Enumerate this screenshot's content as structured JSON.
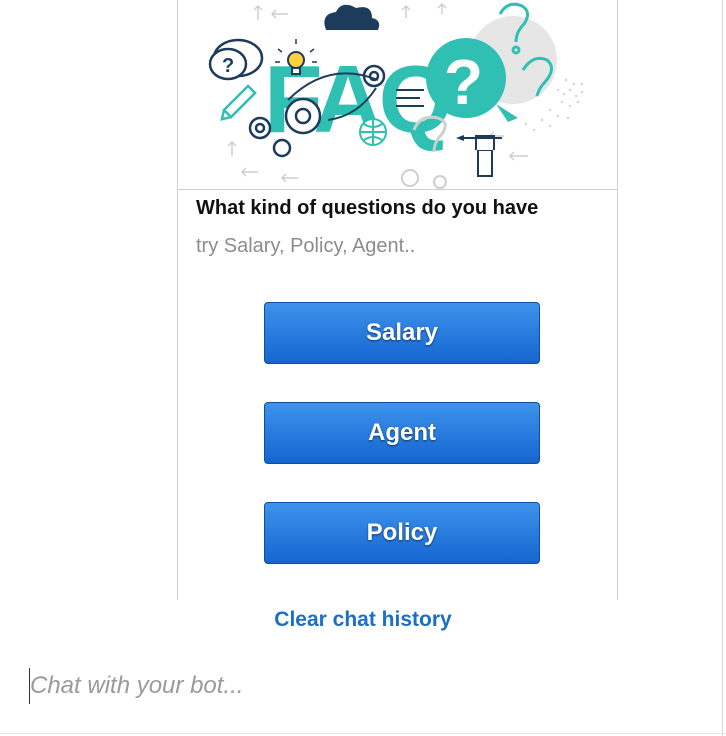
{
  "card": {
    "image_letters": "FAQ",
    "title": "What kind of questions do you have",
    "subtitle": "try Salary, Policy, Agent..",
    "buttons": [
      "Salary",
      "Agent",
      "Policy"
    ]
  },
  "clear_history_label": "Clear chat history",
  "chat": {
    "placeholder": "Chat with your bot...",
    "value": ""
  },
  "colors": {
    "button_top": "#3d93ec",
    "button_bottom": "#1565d0",
    "link": "#1a6fc6",
    "faq_teal": "#2fbfb3",
    "faq_navy": "#1d3b5c"
  }
}
